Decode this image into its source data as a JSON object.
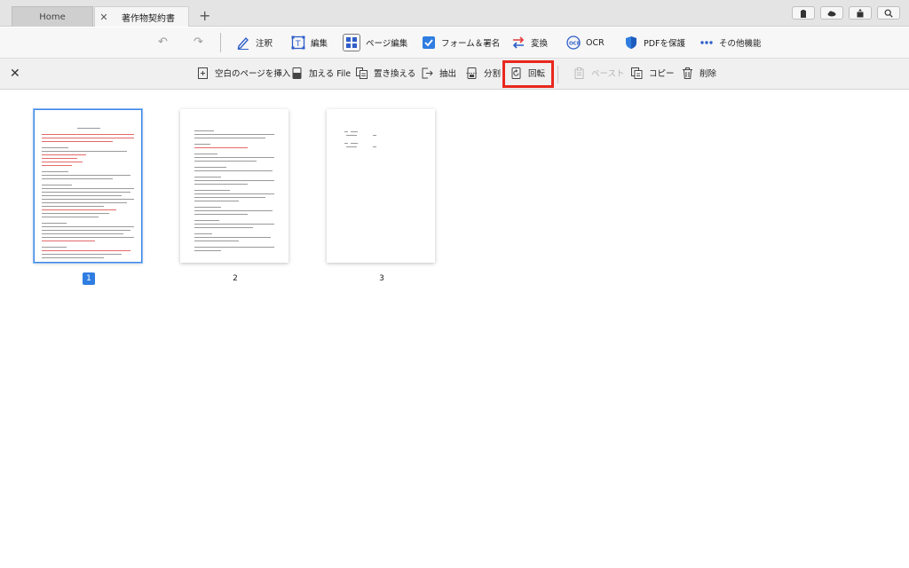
{
  "tabs": [
    {
      "label": "Home",
      "closable": false,
      "active": false
    },
    {
      "label": "著作物契約書",
      "closable": true,
      "active": true
    }
  ],
  "tab_add_label": "+",
  "tab_close_label": "✕",
  "window_icons": [
    "clipboard-icon",
    "cloud-icon",
    "share-icon",
    "search-icon"
  ],
  "toolbar": {
    "undo_icon": "undo-icon",
    "redo_icon": "redo-icon",
    "items": [
      {
        "label": "注釈",
        "icon": "pen-icon"
      },
      {
        "label": "編集",
        "icon": "text-edit-icon"
      },
      {
        "label": "ページ編集",
        "icon": "page-grid-icon",
        "active": true
      },
      {
        "label": "フォーム＆署名",
        "icon": "checkbox-icon"
      },
      {
        "label": "変換",
        "icon": "convert-arrows-icon"
      },
      {
        "label": "OCR",
        "icon": "ocr-icon"
      },
      {
        "label": "PDFを保護",
        "icon": "shield-icon"
      },
      {
        "label": "その他機能",
        "icon": "more-dots-icon"
      }
    ]
  },
  "page_toolbar": {
    "close_label": "✕",
    "items": [
      {
        "label": "空白のページを挿入",
        "icon": "insert-blank-page-icon",
        "enabled": true
      },
      {
        "label": "加える File",
        "icon": "add-file-icon",
        "enabled": true
      },
      {
        "label": "置き換える",
        "icon": "replace-icon",
        "enabled": true
      },
      {
        "label": "抽出",
        "icon": "extract-icon",
        "enabled": true
      },
      {
        "label": "分割",
        "icon": "split-icon",
        "enabled": true
      },
      {
        "label": "回転",
        "icon": "rotate-icon",
        "enabled": true,
        "highlighted": true
      },
      {
        "label": "ペースト",
        "icon": "paste-icon",
        "enabled": false
      },
      {
        "label": "コピー",
        "icon": "copy-icon",
        "enabled": true
      },
      {
        "label": "削除",
        "icon": "trash-icon",
        "enabled": true
      }
    ]
  },
  "pages": [
    {
      "number": "1",
      "selected": true
    },
    {
      "number": "2",
      "selected": false
    },
    {
      "number": "3",
      "selected": false
    }
  ],
  "colors": {
    "accent": "#2f7de1",
    "highlight": "#e8271d",
    "red_text": "#e04040"
  }
}
